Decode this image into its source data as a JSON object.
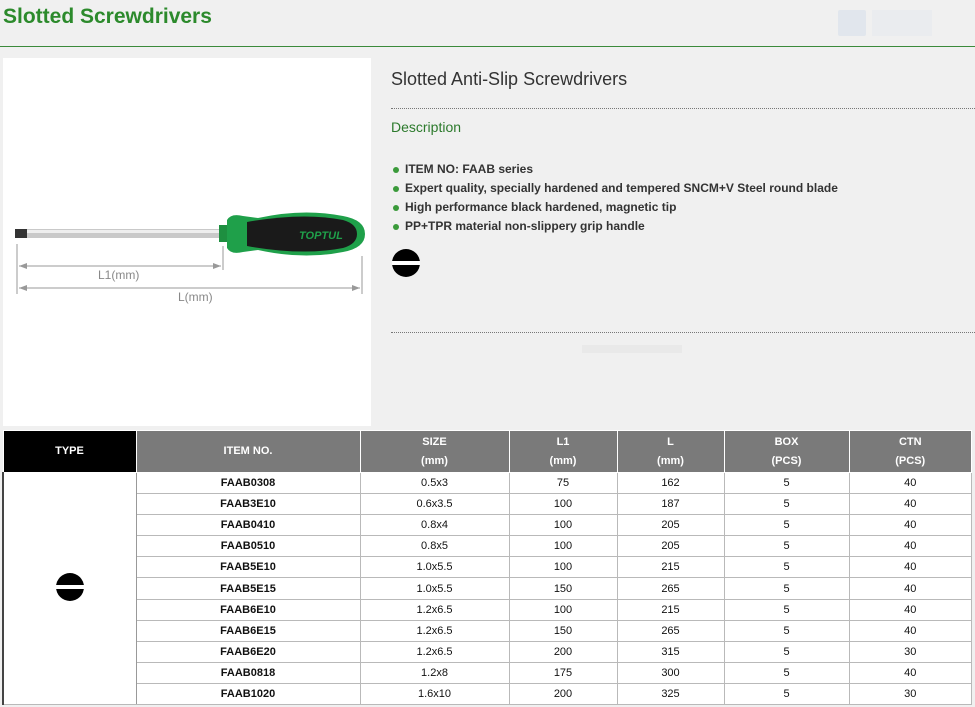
{
  "header": {
    "title": "Slotted Screwdrivers"
  },
  "image": {
    "brand": "TOPTUL",
    "dim_l1": "L1(mm)",
    "dim_l": "L(mm)"
  },
  "product": {
    "name": "Slotted Anti-Slip Screwdrivers",
    "description_heading": "Description",
    "features": [
      "ITEM NO: FAAB series",
      "Expert quality, specially hardened and tempered SNCM+V Steel round blade",
      "High performance black hardened, magnetic tip",
      "PP+TPR material non-slippery grip handle"
    ],
    "tip_icon": "slotted-tip-icon"
  },
  "colors": {
    "accent_green": "#2c8a2c",
    "handle_green": "#1fa04a",
    "header_gray": "#7a7a7a",
    "type_header": "#000000"
  },
  "table": {
    "headers": {
      "type": "TYPE",
      "item_no": "ITEM NO.",
      "size": "SIZE",
      "size_unit": "(mm)",
      "l1": "L1",
      "l1_unit": "(mm)",
      "l": "L",
      "l_unit": "(mm)",
      "box": "BOX",
      "box_unit": "(PCS)",
      "ctn": "CTN",
      "ctn_unit": "(PCS)"
    },
    "type_icon": "slotted-tip-icon",
    "rows": [
      {
        "item": "FAAB0308",
        "size": "0.5x3",
        "l1": "75",
        "l": "162",
        "box": "5",
        "ctn": "40"
      },
      {
        "item": "FAAB3E10",
        "size": "0.6x3.5",
        "l1": "100",
        "l": "187",
        "box": "5",
        "ctn": "40"
      },
      {
        "item": "FAAB0410",
        "size": "0.8x4",
        "l1": "100",
        "l": "205",
        "box": "5",
        "ctn": "40"
      },
      {
        "item": "FAAB0510",
        "size": "0.8x5",
        "l1": "100",
        "l": "205",
        "box": "5",
        "ctn": "40"
      },
      {
        "item": "FAAB5E10",
        "size": "1.0x5.5",
        "l1": "100",
        "l": "215",
        "box": "5",
        "ctn": "40"
      },
      {
        "item": "FAAB5E15",
        "size": "1.0x5.5",
        "l1": "150",
        "l": "265",
        "box": "5",
        "ctn": "40"
      },
      {
        "item": "FAAB6E10",
        "size": "1.2x6.5",
        "l1": "100",
        "l": "215",
        "box": "5",
        "ctn": "40"
      },
      {
        "item": "FAAB6E15",
        "size": "1.2x6.5",
        "l1": "150",
        "l": "265",
        "box": "5",
        "ctn": "40"
      },
      {
        "item": "FAAB6E20",
        "size": "1.2x6.5",
        "l1": "200",
        "l": "315",
        "box": "5",
        "ctn": "30"
      },
      {
        "item": "FAAB0818",
        "size": "1.2x8",
        "l1": "175",
        "l": "300",
        "box": "5",
        "ctn": "40"
      },
      {
        "item": "FAAB1020",
        "size": "1.6x10",
        "l1": "200",
        "l": "325",
        "box": "5",
        "ctn": "30"
      }
    ]
  }
}
